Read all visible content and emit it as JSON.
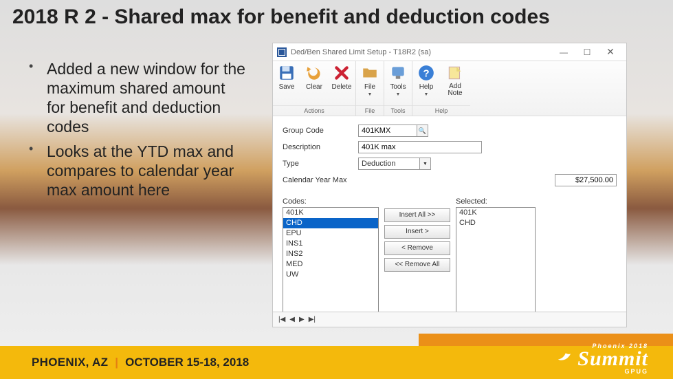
{
  "title": "2018 R 2 - Shared max for benefit and deduction codes",
  "bullets": [
    "Added a new window for the maximum shared amount for benefit and deduction codes",
    "Looks at the YTD max and compares to calendar year max amount here"
  ],
  "window": {
    "title": "Ded/Ben Shared Limit Setup  -  T18R2 (sa)",
    "controls": {
      "min": "—",
      "max": "☐",
      "close": "✕"
    },
    "ribbon": {
      "groups": [
        {
          "label": "Actions",
          "buttons": [
            {
              "name": "save",
              "text": "Save"
            },
            {
              "name": "clear",
              "text": "Clear"
            },
            {
              "name": "delete",
              "text": "Delete"
            }
          ]
        },
        {
          "label": "File",
          "buttons": [
            {
              "name": "file",
              "text": "File",
              "dd": true
            }
          ]
        },
        {
          "label": "Tools",
          "buttons": [
            {
              "name": "tools",
              "text": "Tools",
              "dd": true
            }
          ]
        },
        {
          "label": "Help",
          "buttons": [
            {
              "name": "help",
              "text": "Help",
              "dd": true
            },
            {
              "name": "addnote",
              "text": "Add\nNote"
            }
          ]
        }
      ]
    },
    "fields": {
      "group_code": {
        "label": "Group Code",
        "value": "401KMX"
      },
      "description": {
        "label": "Description",
        "value": "401K max"
      },
      "type": {
        "label": "Type",
        "value": "Deduction"
      },
      "cymax": {
        "label": "Calendar Year Max",
        "value": "$27,500.00"
      }
    },
    "codes_label": "Codes:",
    "selected_label": "Selected:",
    "codes": [
      "401K",
      "CHD",
      "EPU",
      "INS1",
      "INS2",
      "MED",
      "UW"
    ],
    "codes_selected_index": 1,
    "selected": [
      "401K",
      "CHD"
    ],
    "move": {
      "insert_all": "Insert All >>",
      "insert": "Insert >",
      "remove": "< Remove",
      "remove_all": "<< Remove All"
    },
    "nav": [
      "|◀",
      "◀",
      "▶",
      "▶|"
    ]
  },
  "footer": {
    "location": "PHOENIX, AZ",
    "sep": "|",
    "dates": "OCTOBER 15-18, 2018",
    "summit_tag": "Phoenix 2018",
    "summit": "Summit",
    "summit_sub": "GPUG"
  }
}
